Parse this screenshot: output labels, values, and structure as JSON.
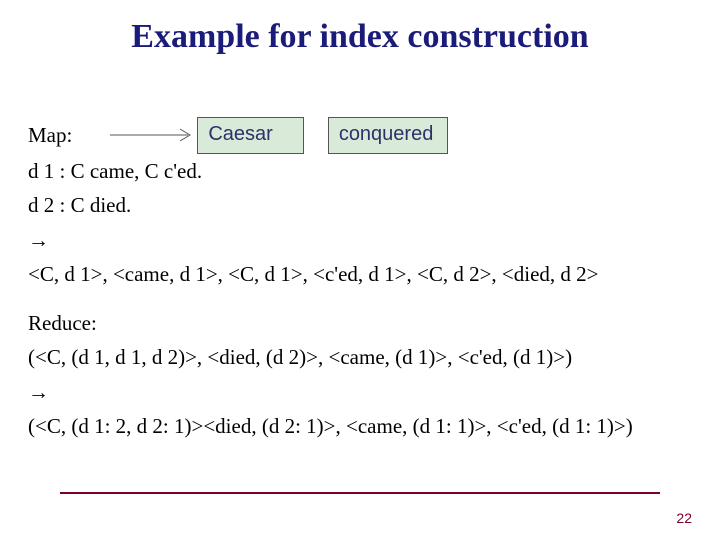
{
  "title": "Example for index construction",
  "map": {
    "label": "Map:",
    "word1": "Caesar",
    "word2": "conquered",
    "d1": "d 1 : C came, C c'ed.",
    "d2": "d 2 : C died.",
    "arrow": "→",
    "pairs": "<C, d 1>, <came, d 1>, <C, d 1>, <c'ed, d 1>, <C, d 2>, <died, d 2>"
  },
  "reduce": {
    "label": "Reduce:",
    "in": "(<C, (d 1, d 1, d 2)>, <died, (d 2)>, <came, (d 1)>, <c'ed, (d 1)>)",
    "arrow": "→",
    "out": "(<C, (d 1: 2, d 2: 1)><died, (d 2: 1)>, <came, (d 1: 1)>, <c'ed, (d 1: 1)>)"
  },
  "page": "22"
}
